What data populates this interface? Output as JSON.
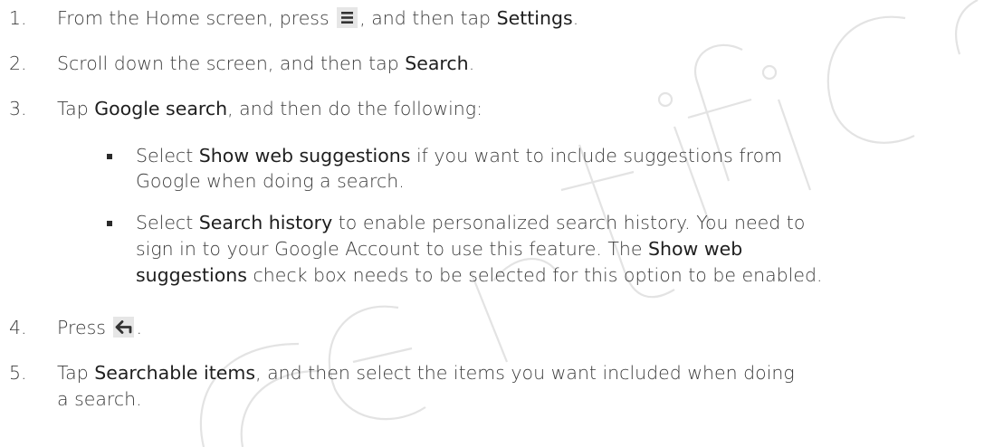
{
  "steps": [
    {
      "number": "1.",
      "parts": [
        "From the Home screen, press ",
        ", and then tap ",
        "Settings",
        "."
      ],
      "icon": "menu-icon"
    },
    {
      "number": "2.",
      "parts": [
        "Scroll down the screen, and then tap ",
        "Search",
        "."
      ]
    },
    {
      "number": "3.",
      "parts": [
        "Tap ",
        "Google search",
        ", and then do the following:"
      ]
    },
    {
      "number": "4.",
      "parts": [
        "Press ",
        "."
      ],
      "icon": "back-icon"
    },
    {
      "number": "5.",
      "lines": [
        [
          "Tap ",
          "Searchable items",
          ", and then select the items you want included when doing"
        ],
        [
          "a search."
        ]
      ]
    }
  ],
  "sub_steps": [
    {
      "lines": [
        [
          "Select ",
          "Show web suggestions",
          " if you want to include suggestions from"
        ],
        [
          "Google when doing a search."
        ]
      ]
    },
    {
      "lines": [
        [
          "Select ",
          "Search history",
          " to enable personalized search history. You need to"
        ],
        [
          "sign in to your Google Account to use this feature. The ",
          "Show web"
        ],
        [
          "suggestions",
          " check box needs to be selected for this option to be enabled."
        ]
      ]
    }
  ],
  "watermark": {
    "text": "r certified",
    "color": "#e9e9e9"
  }
}
